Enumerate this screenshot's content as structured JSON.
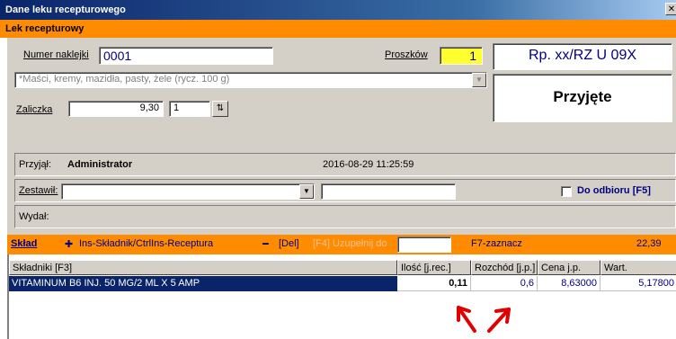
{
  "window": {
    "title": "Dane leku recepturowego",
    "close": "✕"
  },
  "section_header": "Lek recepturowy",
  "form": {
    "numer_label": "Numer naklejki",
    "numer_value": "0001",
    "proszkow_label": "Proszków",
    "proszkow_value": "1",
    "rp_code": "Rp. xx/RZ U 09X",
    "status": "Przyjęte",
    "category_value": "*Maści, kremy, mazidła, pasty, żele (rycz. 100 g)",
    "zaliczka_label": "Zaliczka",
    "zaliczka_value": "9,30",
    "qty_value": "1",
    "przyjal_label": "Przyjął:",
    "przyjal_value": "Administrator",
    "przyjal_timestamp": "2016-08-29 11:25:59",
    "zestawil_label": "Zestawił:",
    "zestawil_value": "",
    "do_odbioru_label": "Do odbioru [F5]",
    "do_odbioru_checked": false,
    "wydal_label": "Wydał:"
  },
  "sklad_bar": {
    "title": "Skład",
    "add_label": "Ins-Składnik/CtrlIns-Receptura",
    "del_label": "[Del]",
    "uzupelnij_label": "[F4] Uzupełnij do",
    "uzupelnij_value": "",
    "zaznacz_label": "F7-zaznacz",
    "total": "22,39"
  },
  "grid": {
    "columns": [
      "Składniki [F3]",
      "Ilość [j.rec.]",
      "Rozchód [j.p.]",
      "Cena j.p.",
      "Wart."
    ],
    "rows": [
      {
        "name": "VITAMINUM B6 INJ. 50 MG/2 ML X 5 AMP",
        "ilosc": "0,11",
        "rozchod": "0,6",
        "cena": "8,63000",
        "wart": "5,17800"
      }
    ]
  },
  "colors": {
    "accent_orange": "#ff8c00",
    "title_blue": "#0a246a",
    "annotation_red": "#e00000"
  }
}
